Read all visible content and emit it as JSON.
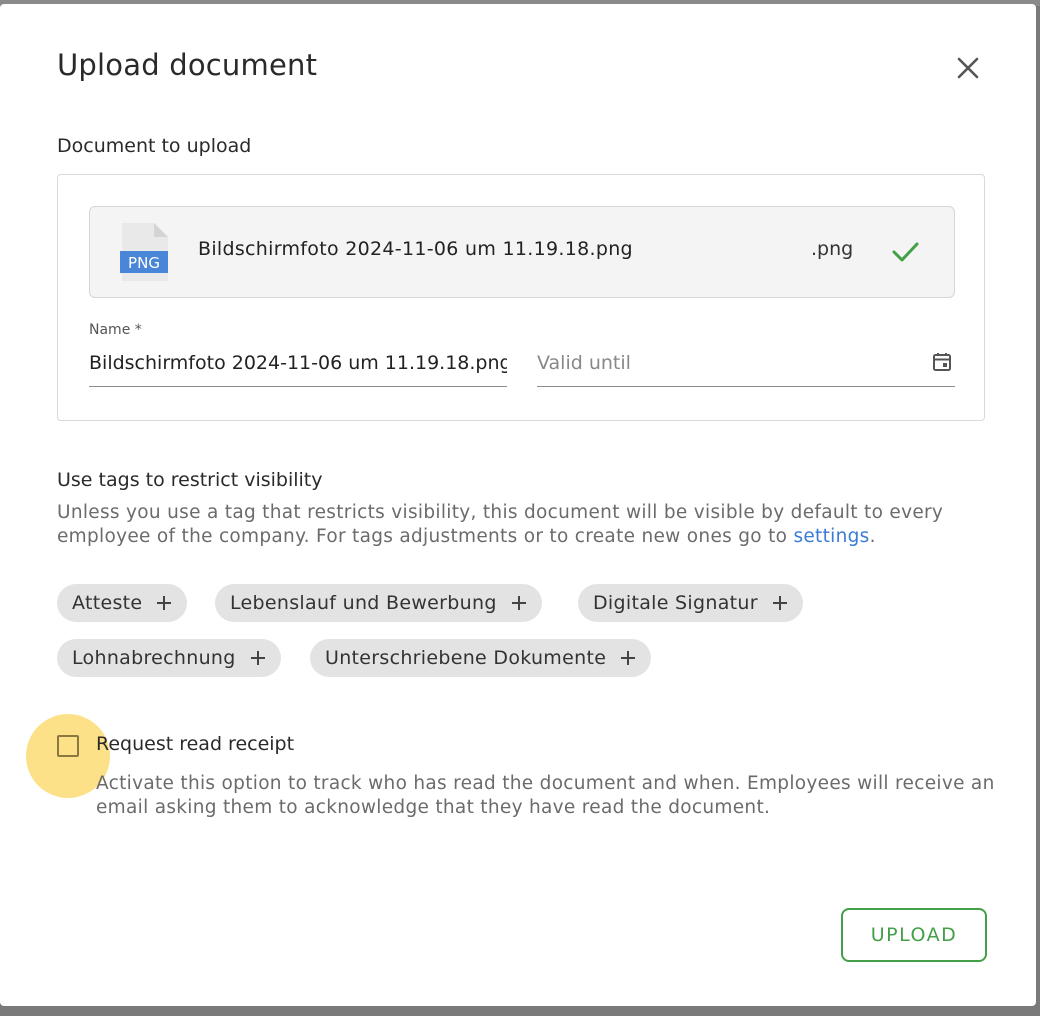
{
  "dialog": {
    "title": "Upload document"
  },
  "document_section": {
    "label": "Document to upload",
    "file": {
      "icon_text": "PNG",
      "name": "Bildschirmfoto 2024-11-06 um 11.19.18.png",
      "extension": ".png",
      "status": "check-icon"
    },
    "name_field": {
      "label": "Name *",
      "value": "Bildschirmfoto 2024-11-06 um 11.19.18.png"
    },
    "valid_until_field": {
      "placeholder": "Valid until",
      "icon": "calendar-icon"
    }
  },
  "tags_section": {
    "title": "Use tags to restrict visibility",
    "description": "Unless you use a tag that restricts visibility, this document will be visible by default to every employee of the company. For tags adjustments or to create new ones go to ",
    "settings_link": "settings",
    "description_end": ".",
    "tags": [
      {
        "label": "Atteste"
      },
      {
        "label": "Lebenslauf und Bewerbung"
      },
      {
        "label": "Digitale Signatur"
      },
      {
        "label": "Lohnabrechnung"
      },
      {
        "label": "Unterschriebene Dokumente"
      }
    ]
  },
  "read_receipt": {
    "label": "Request read receipt",
    "checked": false,
    "description": "Activate this option to track who has read the document and when. Employees will receive an email asking them to acknowledge that they have read the document."
  },
  "actions": {
    "upload_label": "UPLOAD"
  },
  "colors": {
    "accent_green": "#43a047",
    "link_blue": "#3a7bd5",
    "png_badge": "#4a86d8",
    "cursor_highlight": "#fcd65c"
  }
}
